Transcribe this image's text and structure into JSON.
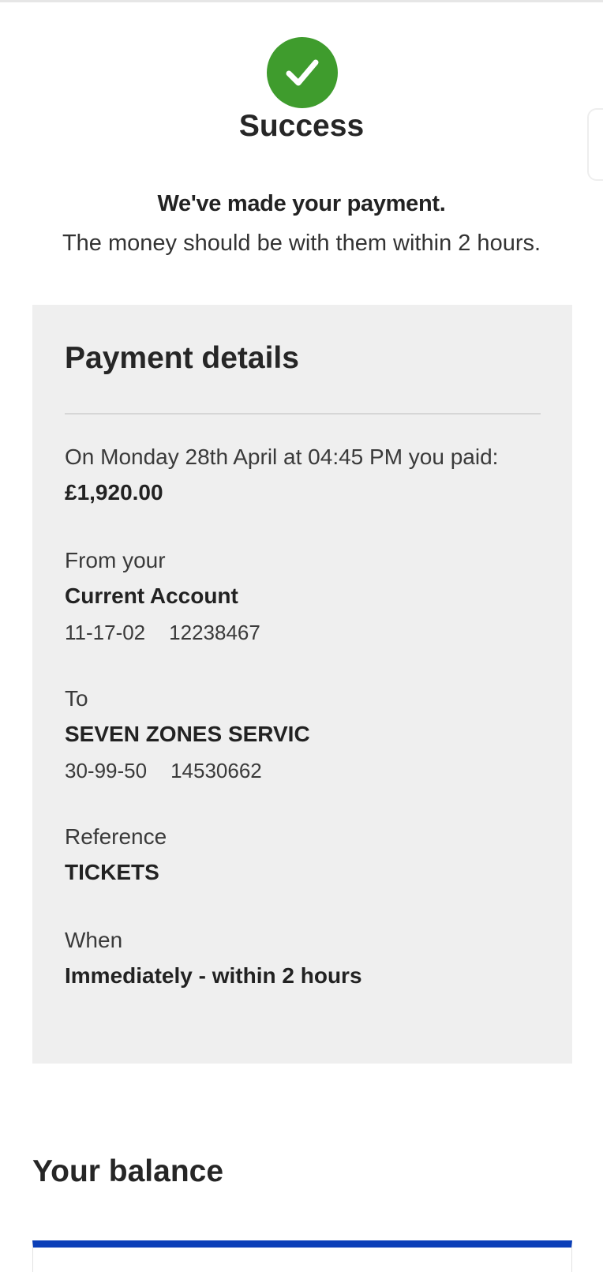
{
  "success": {
    "icon": "check-icon",
    "title": "Success",
    "heading": "We've made your payment.",
    "body": "The money should be with them within 2 hours."
  },
  "payment_details": {
    "title": "Payment details",
    "paid_line": "On Monday 28th April at 04:45 PM you paid:",
    "amount": "£1,920.00",
    "from": {
      "label": "From your",
      "account_name": "Current Account",
      "sort_code": "11-17-02",
      "account_number": "12238467"
    },
    "to": {
      "label": "To",
      "payee_name": "SEVEN ZONES SERVIC",
      "sort_code": "30-99-50",
      "account_number": "14530662"
    },
    "reference": {
      "label": "Reference",
      "value": "TICKETS"
    },
    "when": {
      "label": "When",
      "value": "Immediately - within 2 hours"
    }
  },
  "balance": {
    "title": "Your balance"
  },
  "colors": {
    "success_green": "#3f9c2d",
    "card_background": "#efefef",
    "brand_blue": "#0b3fb8"
  }
}
